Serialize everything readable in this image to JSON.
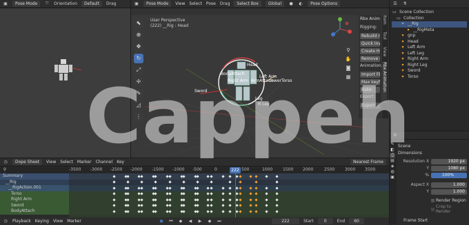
{
  "left_viewport": {
    "mode": "Pose Mode",
    "orientation_label": "Orientation",
    "orientation_value": "Default",
    "drag_label": "Drag"
  },
  "main_viewport": {
    "mode": "Pose Mode",
    "orientation_label": "Orientation",
    "orientation_value": "Default",
    "drag_label": "Drag",
    "drag_value": "Select Box",
    "transform_value": "Global",
    "pose_options": "Pose Options",
    "menus": [
      "View",
      "Select",
      "Pose"
    ],
    "perspective": "User Perspective",
    "context": "(222) __Rig : Head",
    "bone_labels": [
      "Head",
      "BodyAttach",
      "Right Arm",
      "Left Arm",
      "ArmAttach",
      "LowerTorso",
      "Sword",
      "Leg",
      "R Leg"
    ]
  },
  "rbx_panel": {
    "header": "Rbx Anim",
    "rigging": "Rigging:",
    "rebuild": "Rebuild rig",
    "quick": "Quick inv...",
    "create": "Create H...",
    "remove": "Remove C...",
    "animation": "Animation...",
    "import_fbx": "Import FBX",
    "max_keyf": "Max keyf...",
    "bake": "Bake",
    "export": "Export:",
    "export_btn": "Export",
    "side_tabs": [
      "Item",
      "Tool",
      "View",
      "Rbx Animation"
    ]
  },
  "outliner": {
    "scene_collection": "Scene Collection",
    "collection": "Collection",
    "items": [
      "__Rig",
      "__RigMeta",
      "gnp",
      "Head",
      "Left Arm",
      "Left Leg",
      "Right Arm",
      "Right Leg",
      "Sword",
      "Torso"
    ]
  },
  "properties": {
    "scene": "Scene",
    "dimensions": "Dimensions",
    "resolution_x_label": "Resolution X",
    "resolution_x": "1920 px",
    "resolution_y_label": "Y",
    "resolution_y": "1080 px",
    "percent_label": "%",
    "percent": "100%",
    "aspect_x_label": "Aspect X",
    "aspect_x": "1.000",
    "aspect_y_label": "Y",
    "aspect_y": "1.000",
    "render_region": "Render Region",
    "crop_render": "Crop to Render",
    "frame_start": "Frame Start"
  },
  "dopesheet": {
    "mode": "Dope Sheet",
    "menus": [
      "View",
      "Select",
      "Marker",
      "Channel",
      "Key"
    ],
    "snap": "Nearest Frame",
    "ticks": [
      "-3500",
      "-3000",
      "-2500",
      "-2000",
      "-1500",
      "-1000",
      "-500",
      "0",
      "222",
      "500",
      "1000",
      "1500",
      "2000",
      "2500",
      "3000",
      "3500"
    ],
    "current_frame": "222",
    "channels": [
      "Summary",
      "__Rig",
      "__RigAction.001",
      "Torso",
      "Right Arm",
      "Sword",
      "BodyAttach"
    ]
  },
  "timeline": {
    "playback": "Playback",
    "keying": "Keying",
    "view": "View",
    "marker": "Marker",
    "frame": "222",
    "start_label": "Start",
    "start": "0",
    "end_label": "End",
    "end": "60"
  },
  "watermark": "Cappeh",
  "colors": {
    "accent": "#4772b3",
    "summary_row": "#3a4f6e",
    "action_row": "#38536b",
    "bone_row": "#3a5a34",
    "keyframe": "#e8e8e8",
    "playhead": "#4772b3"
  }
}
